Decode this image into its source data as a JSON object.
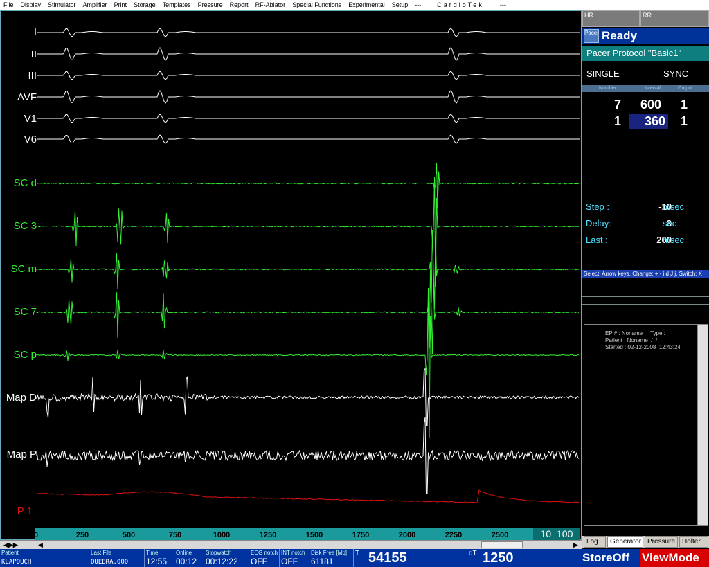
{
  "menu": [
    "File",
    "Display",
    "Stimulator",
    "Amplifier",
    "Print",
    "Storage",
    "Templates",
    "Pressure",
    "Report",
    "RF-Ablator",
    "Special Functions",
    "Experimental",
    "Setup",
    "---",
    "CardioTek",
    "---"
  ],
  "channels": {
    "ecg": [
      "I",
      "II",
      "III",
      "AVF",
      "V1",
      "V6"
    ],
    "sc": [
      "SC d",
      "SC 3",
      "SC m",
      "SC 7",
      "SC p"
    ],
    "map": [
      "Map D",
      "Map P"
    ],
    "pressure": "P 1"
  },
  "colors": {
    "ecg": "#ffffff",
    "sc": "#33ee33",
    "pressure": "#e01010",
    "accent_teal": "#1a9a9a",
    "status_blue": "#0033a0",
    "viewmode_red": "#d80000"
  },
  "xaxis": {
    "ticks": [
      "0",
      "250",
      "500",
      "750",
      "1000",
      "1250",
      "1500",
      "1750",
      "2000",
      "2250",
      "2500"
    ],
    "gain_a": "10",
    "gain_b": "100"
  },
  "right_panel": {
    "hr_label": "HR",
    "rr_label": "RR",
    "pacer_label": "Pacer",
    "status": "Ready",
    "protocol": "Pacer Protocol \"Basic1\"",
    "mode": "SINGLE",
    "sync": "SYNC",
    "columns": {
      "number": "Number",
      "interval": "Interval",
      "output": "Output"
    },
    "rows": [
      {
        "number": "7",
        "interval": "600",
        "output": "1"
      },
      {
        "number": "1",
        "interval": "360",
        "output": "1"
      }
    ],
    "settings": [
      {
        "key": "Step :",
        "value": "-10",
        "unit": "msec"
      },
      {
        "key": "Delay:",
        "value": "3",
        "unit": "sec"
      },
      {
        "key": "Last :",
        "value": "200",
        "unit": "msec"
      }
    ],
    "hint": "Select: Arrow keys. Change: + - i d J j. Switch: X",
    "log": {
      "line1": "EP # : Noname     Type :",
      "line2": "Patient : Noname  /  /",
      "line3": "Started : 02-12-2008  12:43:24"
    },
    "tabs": [
      "Log",
      "Generator",
      "Pressure",
      "Holter"
    ],
    "active_tab": "Generator"
  },
  "status_bar": {
    "patient_label": "Patient",
    "patient_value": "KLAPOUCH",
    "lastfile_label": "Last File",
    "lastfile_value": "QUEBRA.000",
    "time_label": "Time",
    "time_value": "12:55",
    "online_label": "Online",
    "online_value": "00:12",
    "stopwatch_label": "Stopwatch",
    "stopwatch_value": "00:12:22",
    "ecgnotch_label": "ECG notch",
    "ecgnotch_value": "OFF",
    "intnotch_label": "INT notch",
    "intnotch_value": "OFF",
    "disk_label": "Disk Free [Mb]",
    "disk_value": "61181",
    "t_label": "T",
    "t_value": "54155",
    "dt_label": "dT",
    "dt_value": "1250",
    "storeoff": "StoreOff",
    "viewmode": "ViewMode"
  }
}
